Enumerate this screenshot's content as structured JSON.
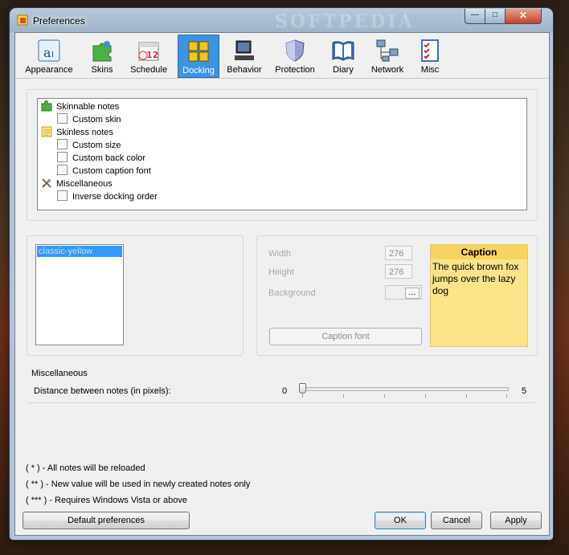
{
  "window": {
    "title": "Preferences",
    "watermark": "SOFTPEDIA"
  },
  "tabs": [
    {
      "label": "Appearance",
      "icon": "appearance-icon"
    },
    {
      "label": "Skins",
      "icon": "puzzle-icon"
    },
    {
      "label": "Schedule",
      "icon": "calendar-icon"
    },
    {
      "label": "Docking",
      "icon": "docking-grid-icon",
      "selected": true
    },
    {
      "label": "Behavior",
      "icon": "computer-icon"
    },
    {
      "label": "Protection",
      "icon": "shield-icon"
    },
    {
      "label": "Diary",
      "icon": "book-icon"
    },
    {
      "label": "Network",
      "icon": "network-icon"
    },
    {
      "label": "Misc",
      "icon": "checklist-icon"
    }
  ],
  "tree": {
    "skinnable": "Skinnable notes",
    "custom_skin": "Custom skin",
    "skinless": "Skinless notes",
    "custom_size": "Custom size",
    "custom_back_color": "Custom back color",
    "custom_caption_font": "Custom caption font",
    "misc": "Miscellaneous",
    "inverse_docking": "Inverse docking order"
  },
  "skin_list": {
    "selected": "classic-yellow"
  },
  "size_panel": {
    "width_label": "Width",
    "width_value": "276",
    "height_label": "Height",
    "height_value": "276",
    "background_label": "Background",
    "background_btn": "...",
    "caption_font_btn": "Caption font"
  },
  "preview": {
    "caption": "Caption",
    "text": "The quick brown fox jumps over the lazy dog",
    "color": "#fbe38a"
  },
  "misc_section": {
    "title": "Miscellaneous",
    "distance_label": "Distance between notes (in pixels):",
    "min": "0",
    "max": "5",
    "value": 0
  },
  "footnotes": {
    "one": "( * ) - All notes will be reloaded",
    "two": "( ** ) - New value will be used in newly created notes only",
    "three": "( *** ) - Requires Windows Vista or above"
  },
  "buttons": {
    "default_prefs": "Default preferences",
    "ok": "OK",
    "cancel": "Cancel",
    "apply": "Apply"
  },
  "colors": {
    "selected_tab": "#3b94e4",
    "selection": "#3399ff"
  }
}
